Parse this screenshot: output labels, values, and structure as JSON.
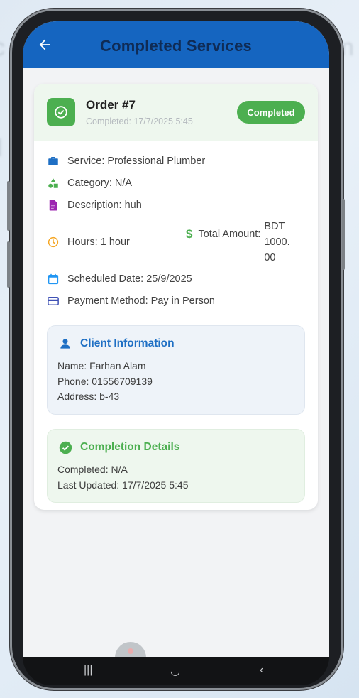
{
  "appbar": {
    "title": "Completed Services"
  },
  "order": {
    "title": "Order #7",
    "completed_at": "Completed: 17/7/2025 5:45",
    "status": "Completed"
  },
  "details": {
    "service": "Service: Professional Plumber",
    "category": "Category: N/A",
    "description": "Description: huh",
    "hours": "Hours: 1 hour",
    "total_label": "Total Amount:",
    "total_value_lines": [
      "BDT",
      "1000.",
      "00"
    ],
    "scheduled": "Scheduled Date: 25/9/2025",
    "payment": "Payment Method: Pay in Person"
  },
  "client": {
    "heading": "Client Information",
    "name": "Name: Farhan Alam",
    "phone": "Phone: 01556709139",
    "address": "Address: b-43"
  },
  "completion": {
    "heading": "Completion Details",
    "completed": "Completed: N/A",
    "last_updated": "Last Updated: 17/7/2025 5:45"
  },
  "colors": {
    "appbar": "#1565c0",
    "status_green": "#4caf50",
    "client_blue": "#1e6fc4",
    "completion_green": "#4caf50"
  },
  "icons": {
    "back": "arrow-left-icon",
    "order": "check-circle-icon",
    "service": "briefcase-icon",
    "category": "shapes-icon",
    "description": "document-icon",
    "hours": "clock-icon",
    "amount": "dollar-icon",
    "scheduled": "calendar-icon",
    "payment": "credit-card-icon",
    "client": "person-icon",
    "completion": "check-circle-filled-icon"
  }
}
